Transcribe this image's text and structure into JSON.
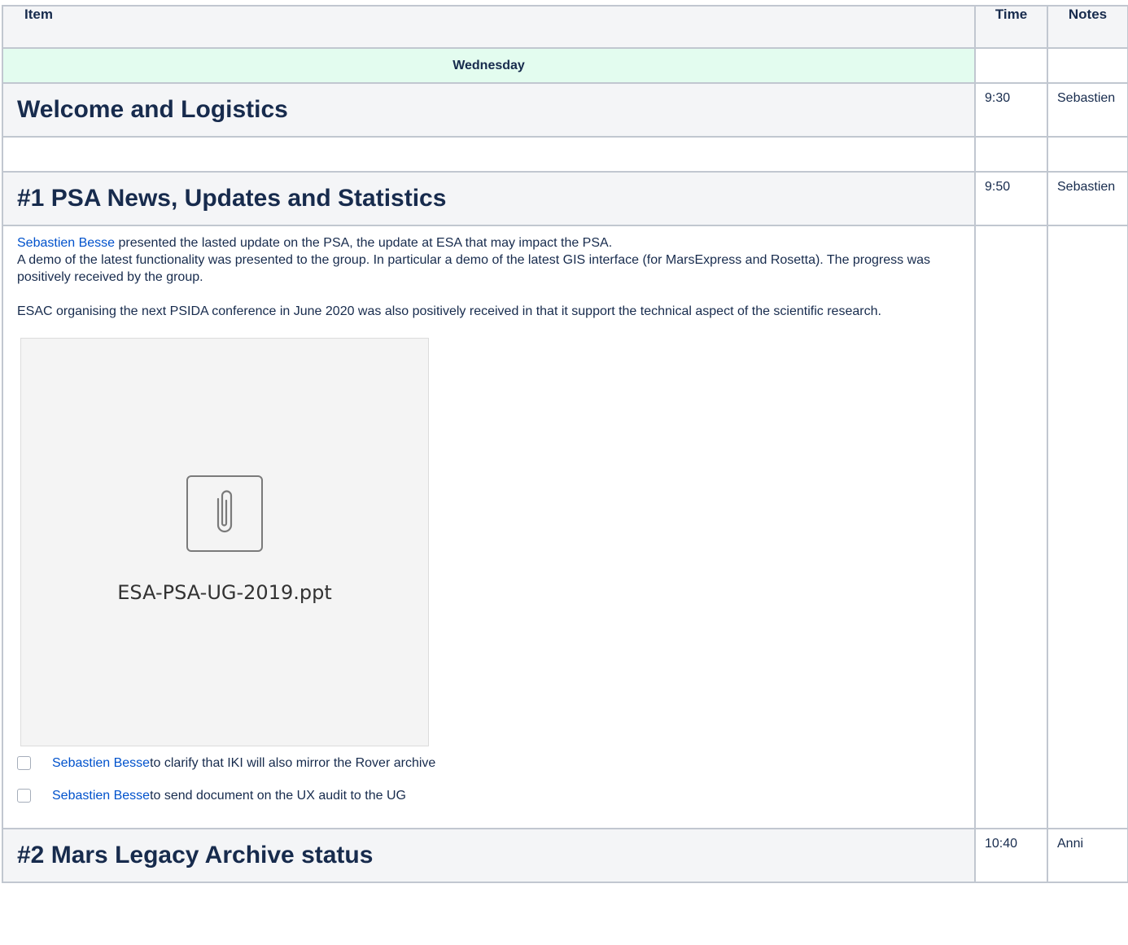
{
  "header": {
    "item": "Item",
    "time": "Time",
    "notes": "Notes"
  },
  "day": "Wednesday",
  "sections": [
    {
      "title": "Welcome and Logistics",
      "time": "9:30",
      "notes": "Sebastien"
    },
    {
      "title": "#1 PSA News, Updates and Statistics",
      "time": "9:50",
      "notes": "Sebastien"
    },
    {
      "title": "#2 Mars Legacy Archive status",
      "time": "10:40",
      "notes": "Anni"
    }
  ],
  "psa": {
    "p1_mention": "Sebastien Besse",
    "p1_text": " presented the lasted update on the PSA, the update at ESA that may impact the PSA.",
    "p1_line2": "A demo of the latest functionality was presented to the group. In particular a demo of the latest GIS interface (for MarsExpress and Rosetta). The progress was positively received by the group.",
    "p2": "ESAC organising the next PSIDA conference in June 2020 was also positively received in that it support the technical aspect of the scientific research.",
    "attachment_name": "ESA-PSA-UG-2019.ppt",
    "tasks": [
      {
        "mention": "Sebastien Besse",
        "text": " to clarify that IKI will also mirror the Rover archive",
        "checked": false
      },
      {
        "mention": "Sebastien Besse",
        "text": " to send document on the UX audit to the UG",
        "checked": false
      }
    ]
  },
  "colors": {
    "link": "#0052cc",
    "header_bg": "#f4f5f7",
    "day_bg": "#e3fcef",
    "border": "#c1c7d0"
  },
  "icons": {
    "attachment": "paperclip-icon",
    "task_checkbox": "checkbox-icon"
  }
}
